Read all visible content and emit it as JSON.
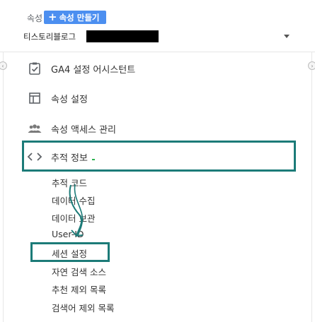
{
  "header": {
    "property_label": "속성",
    "create_button_label": "+ 속성 만들기",
    "create_button_text": "속성 만들기",
    "selected_property": "티스토리블로그",
    "property_select_icon": "chevron-down-icon"
  },
  "nav": {
    "items": [
      {
        "label": "GA4 설정 어시스턴트",
        "icon": "checklist-icon"
      },
      {
        "label": "속성 설정",
        "icon": "window-icon"
      },
      {
        "label": "속성 액세스 관리",
        "icon": "people-icon"
      },
      {
        "label": "추적 정보",
        "icon": "code-icon",
        "expanded": true
      }
    ],
    "tracking_subitems": [
      "추적 코드",
      "데이터 수집",
      "데이터 보관",
      "User-ID",
      "세션 설정",
      "자연 검색 소스",
      "추천 제외 목록",
      "검색어 제외 목록"
    ]
  },
  "annotations": {
    "highlight_color": "#1c7b78",
    "accent_label_color": "#c8402c",
    "button_color": "#4c8ff0"
  }
}
